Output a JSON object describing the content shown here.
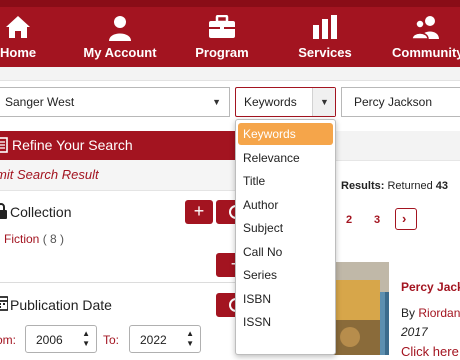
{
  "nav": {
    "items": [
      {
        "label": "Home",
        "icon": "home-icon"
      },
      {
        "label": "My Account",
        "icon": "person-icon"
      },
      {
        "label": "Program",
        "icon": "briefcase-icon"
      },
      {
        "label": "Services",
        "icon": "bar-chart-icon"
      },
      {
        "label": "Community",
        "icon": "people-icon"
      }
    ]
  },
  "search": {
    "library": "Sanger West",
    "field": "Keywords",
    "query": "Percy Jackson"
  },
  "dropdown": {
    "options": [
      "Keywords",
      "Relevance",
      "Title",
      "Author",
      "Subject",
      "Call No",
      "Series",
      "ISBN",
      "ISSN"
    ],
    "selected": "Keywords"
  },
  "refine": {
    "title": "Refine Your Search",
    "limit_label": "mit Search Result",
    "collection": {
      "title": "Collection",
      "item_label": "Fiction",
      "item_count": "( 8 )",
      "add_label": "+"
    },
    "publication_date": {
      "title": "Publication Date",
      "from_label": "om:",
      "from_year": "2006",
      "to_label": "To:",
      "to_year": "2022"
    }
  },
  "results": {
    "label": "Results:",
    "returned_text": "Returned",
    "count": "43",
    "pages": [
      "2",
      "3"
    ],
    "next": "›"
  },
  "book": {
    "title": "Percy Jack",
    "by_label": "By",
    "author": "Riordan",
    "year": "2017",
    "link": "Click here"
  },
  "colors": {
    "brand": "#a31420",
    "highlight": "#f5a54a"
  }
}
